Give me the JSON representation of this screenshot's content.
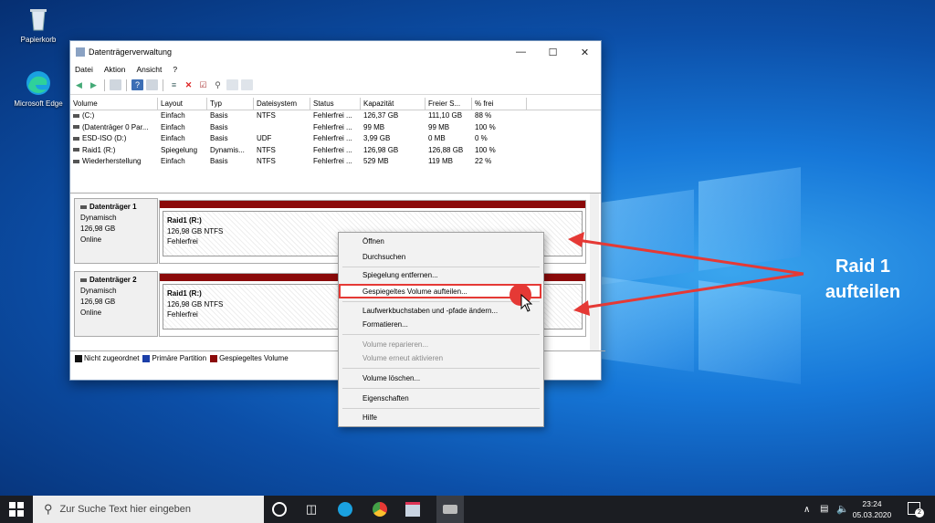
{
  "desktop": {
    "icons": [
      {
        "label": "Papierkorb"
      },
      {
        "label": "Microsoft Edge"
      }
    ],
    "annotation": {
      "line1": "Raid 1",
      "line2": "aufteilen"
    }
  },
  "window": {
    "title": "Datenträgerverwaltung",
    "menu": [
      "Datei",
      "Aktion",
      "Ansicht",
      "?"
    ],
    "columns": [
      "Volume",
      "Layout",
      "Typ",
      "Dateisystem",
      "Status",
      "Kapazität",
      "Freier S...",
      "% frei"
    ],
    "rows": [
      [
        "(C:)",
        "Einfach",
        "Basis",
        "NTFS",
        "Fehlerfrei ...",
        "126,37 GB",
        "111,10 GB",
        "88 %"
      ],
      [
        "(Datenträger 0 Par...",
        "Einfach",
        "Basis",
        "",
        "Fehlerfrei ...",
        "99 MB",
        "99 MB",
        "100 %"
      ],
      [
        "ESD-ISO (D:)",
        "Einfach",
        "Basis",
        "UDF",
        "Fehlerfrei ...",
        "3,99 GB",
        "0 MB",
        "0 %"
      ],
      [
        "Raid1 (R:)",
        "Spiegelung",
        "Dynamis...",
        "NTFS",
        "Fehlerfrei ...",
        "126,98 GB",
        "126,88 GB",
        "100 %"
      ],
      [
        "Wiederherstellung",
        "Einfach",
        "Basis",
        "NTFS",
        "Fehlerfrei ...",
        "529 MB",
        "119 MB",
        "22 %"
      ]
    ],
    "disks": [
      {
        "name": "Datenträger 1",
        "type": "Dynamisch",
        "size": "126,98 GB",
        "state": "Online",
        "vol_name": "Raid1  (R:)",
        "vol_size": "126,98 GB NTFS",
        "vol_status": "Fehlerfrei"
      },
      {
        "name": "Datenträger 2",
        "type": "Dynamisch",
        "size": "126,98 GB",
        "state": "Online",
        "vol_name": "Raid1  (R:)",
        "vol_size": "126,98 GB NTFS",
        "vol_status": "Fehlerfrei"
      }
    ],
    "legend": [
      {
        "label": "Nicht zugeordnet",
        "color": "#111111"
      },
      {
        "label": "Primäre Partition",
        "color": "#1c3fa8"
      },
      {
        "label": "Gespiegeltes Volume",
        "color": "#8b0a0a"
      }
    ]
  },
  "context_menu": {
    "items": [
      {
        "label": "Öffnen",
        "enabled": true
      },
      {
        "label": "Durchsuchen",
        "enabled": true
      },
      {
        "label": "Spiegelung entfernen...",
        "enabled": true
      },
      {
        "label": "Gespiegeltes Volume aufteilen...",
        "enabled": true,
        "highlighted": true
      },
      {
        "label": "Laufwerkbuchstaben und -pfade ändern...",
        "enabled": true
      },
      {
        "label": "Formatieren...",
        "enabled": true
      },
      {
        "label": "Volume reparieren...",
        "enabled": false
      },
      {
        "label": "Volume erneut aktivieren",
        "enabled": false
      },
      {
        "label": "Volume löschen...",
        "enabled": true
      },
      {
        "label": "Eigenschaften",
        "enabled": true
      },
      {
        "label": "Hilfe",
        "enabled": true
      }
    ]
  },
  "taskbar": {
    "search_placeholder": "Zur Suche Text hier eingeben",
    "time": "23:24",
    "date": "05.03.2020",
    "notification_count": "2"
  },
  "colors": {
    "accent_red": "#e53935",
    "mirror_volume": "#8b0a0a"
  }
}
